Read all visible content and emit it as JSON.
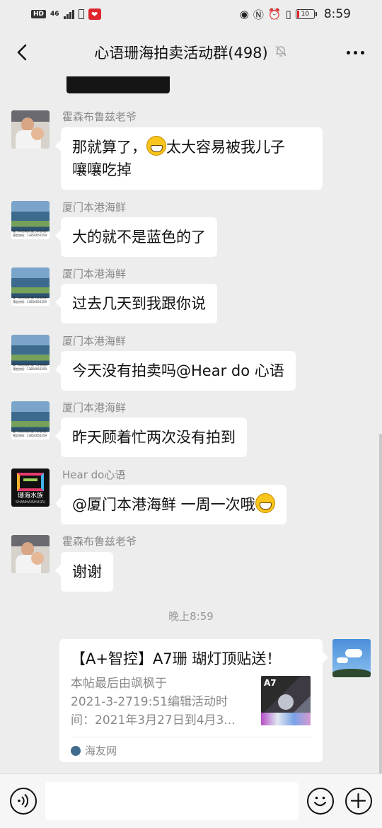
{
  "status_bar": {
    "hd": "HD",
    "network": "46",
    "battery": "10",
    "time": "8:59"
  },
  "header": {
    "title": "心语珊海拍卖活动群(498)"
  },
  "messages": [
    {
      "sender": "霍森布鲁兹老爷",
      "text_a": "那就算了，",
      "text_b": "太大容易被我儿子",
      "text_c": "嚷嚷吃掉",
      "avatar": "man-with-child"
    },
    {
      "sender": "厦门本港海鲜",
      "text": "大的就不是蓝色的了",
      "avatar": "sea-bay"
    },
    {
      "sender": "厦门本港海鲜",
      "text": "过去几天到我跟你说",
      "avatar": "sea-bay"
    },
    {
      "sender": "厦门本港海鲜",
      "text": "今天没有拍卖吗@Hear do 心语",
      "avatar": "sea-bay"
    },
    {
      "sender": "厦门本港海鲜",
      "text": "昨天顾着忙两次没有拍到",
      "avatar": "sea-bay"
    },
    {
      "sender": "Hear do心语",
      "text": "@厦门本港海鲜  一周一次哦",
      "avatar": "logo"
    },
    {
      "sender": "霍森布鲁兹老爷",
      "text": "谢谢",
      "avatar": "man-with-child"
    }
  ],
  "sea_avatar": {
    "line1": "厦门本港海鲜   厦门本港海鲜",
    "line2": "预定热线：13850050359"
  },
  "logo_avatar": {
    "caption": "珊海水族",
    "sub": "SHANHAISHUIZU"
  },
  "timestamp": "晚上8:59",
  "shared_card": {
    "title": "【A+智控】A7珊 瑚灯顶贴送！",
    "desc_lines": [
      "本帖最后由飒枫于",
      "2021-3-2719:51编辑活动时",
      "间：2021年3月27日到4月3..."
    ],
    "thumb_label": "A7",
    "source": "海友网"
  },
  "icons": [
    "back-arrow-icon",
    "mute-bell-icon",
    "more-icon",
    "voice-icon",
    "emoji-icon",
    "plus-icon",
    "grin-emoji-icon"
  ]
}
